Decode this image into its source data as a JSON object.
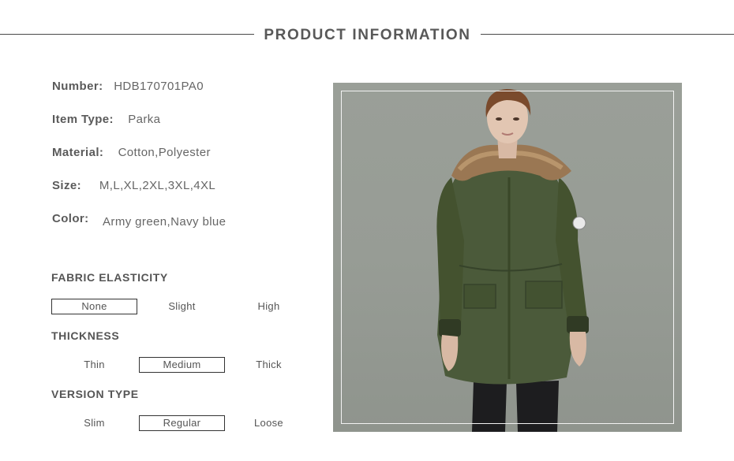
{
  "header": {
    "title": "PRODUCT INFORMATION"
  },
  "specs": [
    {
      "label": "Number:",
      "value": "HDB170701PA0"
    },
    {
      "label": "Item Type:",
      "value": "Parka"
    },
    {
      "label": "Material:",
      "value": "Cotton,Polyester"
    },
    {
      "label": "Size:",
      "value": "M,L,XL,2XL,3XL,4XL"
    },
    {
      "label": "Color:",
      "value": "Army green,Navy blue"
    }
  ],
  "attributes": [
    {
      "title": "FABRIC ELASTICITY",
      "options": [
        "None",
        "Slight",
        "High"
      ],
      "selected": "None"
    },
    {
      "title": "THICKNESS",
      "options": [
        "Thin",
        "Medium",
        "Thick"
      ],
      "selected": "Medium"
    },
    {
      "title": "VERSION TYPE",
      "options": [
        "Slim",
        "Regular",
        "Loose"
      ],
      "selected": "Regular"
    }
  ],
  "colors": {
    "coat": "#4b5a3a",
    "background": "#979c95",
    "text": "#555555"
  }
}
